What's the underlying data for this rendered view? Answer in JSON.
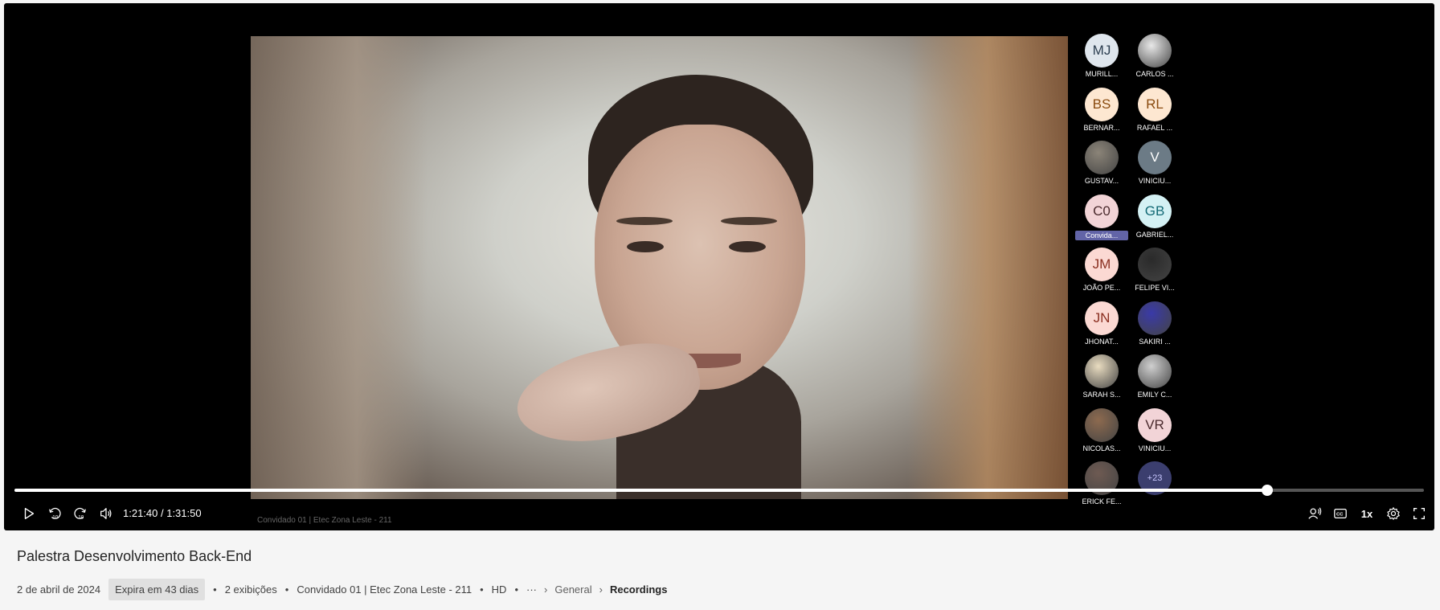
{
  "video": {
    "watermark": "Convidado 01 | Etec Zona Leste - 211"
  },
  "participants": [
    {
      "initials": "MJ",
      "name": "MURILL...",
      "bg": "#dfe6ed",
      "fg": "#2c3e50",
      "photo": false
    },
    {
      "initials": "",
      "name": "CARLOS ...",
      "bg": "#e8e8e8",
      "fg": "#333",
      "photo": true
    },
    {
      "initials": "BS",
      "name": "BERNAR...",
      "bg": "#fde7d1",
      "fg": "#8a4b0f",
      "photo": false
    },
    {
      "initials": "RL",
      "name": "RAFAEL ...",
      "bg": "#fde7d1",
      "fg": "#8a4b0f",
      "photo": false
    },
    {
      "initials": "",
      "name": "GUSTAV...",
      "bg": "#8b8478",
      "fg": "#fff",
      "photo": true
    },
    {
      "initials": "V",
      "name": "VINICIU...",
      "bg": "#6c7b86",
      "fg": "#fff",
      "photo": false
    },
    {
      "initials": "C0",
      "name": "Convida...",
      "bg": "#f2d4d7",
      "fg": "#4a2a2d",
      "photo": false,
      "badge": true
    },
    {
      "initials": "GB",
      "name": "GABRIEL...",
      "bg": "#d4f1f4",
      "fg": "#136a76",
      "photo": false
    },
    {
      "initials": "JM",
      "name": "JOÃO PE...",
      "bg": "#fbd9d3",
      "fg": "#8a2f20",
      "photo": false
    },
    {
      "initials": "",
      "name": "FELIPE VI...",
      "bg": "#2a2a2a",
      "fg": "#fff",
      "photo": true
    },
    {
      "initials": "JN",
      "name": "JHONAT...",
      "bg": "#fbd9d3",
      "fg": "#8a2f20",
      "photo": false
    },
    {
      "initials": "",
      "name": "SAKIRI ...",
      "bg": "#3a3aa8",
      "fg": "#fff",
      "photo": true
    },
    {
      "initials": "",
      "name": "SARAH S...",
      "bg": "#e9dcc0",
      "fg": "#333",
      "photo": true
    },
    {
      "initials": "",
      "name": "EMILY C...",
      "bg": "#cfcfcf",
      "fg": "#333",
      "photo": true
    },
    {
      "initials": "",
      "name": "NICOLAS...",
      "bg": "#8d6a4f",
      "fg": "#fff",
      "photo": true
    },
    {
      "initials": "VR",
      "name": "VINICIU...",
      "bg": "#f2d4d7",
      "fg": "#4a2a2d",
      "photo": false
    },
    {
      "initials": "",
      "name": "ERICK FE...",
      "bg": "#6e5a52",
      "fg": "#fff",
      "photo": true
    },
    {
      "initials": "+23",
      "name": "",
      "bg": "#3b3e6e",
      "fg": "#c8c8ff",
      "photo": false,
      "more": true
    }
  ],
  "playback": {
    "current": "1:21:40",
    "duration": "1:31:50",
    "time_display": "1:21:40 / 1:31:50",
    "progress_fraction": 0.889,
    "speed": "1x"
  },
  "icons": {
    "play": "play-icon",
    "rewind": "rewind-10-icon",
    "forward": "forward-10-icon",
    "volume": "volume-icon",
    "speaker_track": "speaker-icon",
    "captions": "captions-icon",
    "settings": "gear-icon",
    "fullscreen": "fullscreen-icon"
  },
  "meeting": {
    "title": "Palestra Desenvolvimento Back-End",
    "date": "2 de abril de 2024",
    "expires": "Expira em 43 dias",
    "views": "2 exibições",
    "owner": "Convidado 01 | Etec Zona Leste - 211",
    "quality": "HD",
    "more_label": "···",
    "breadcrumb": [
      "General",
      "Recordings"
    ]
  }
}
